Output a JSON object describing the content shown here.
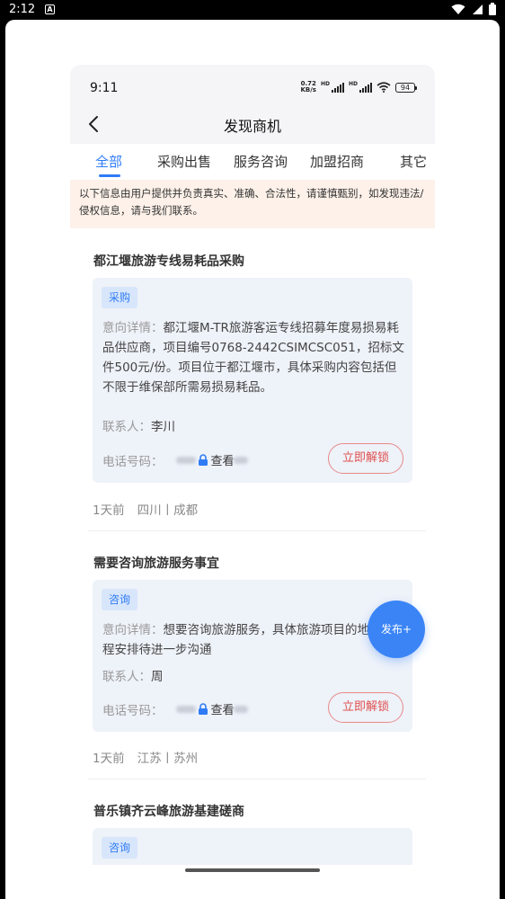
{
  "system_status": {
    "time": "2:12",
    "notification_letter": "A"
  },
  "inner_status": {
    "time": "9:11",
    "speed_value": "0.72",
    "speed_unit": "KB/s",
    "hd_label": "HD",
    "battery": "94"
  },
  "nav": {
    "title": "发现商机"
  },
  "tabs": [
    {
      "label": "全部",
      "active": true
    },
    {
      "label": "采购出售",
      "active": false
    },
    {
      "label": "服务咨询",
      "active": false
    },
    {
      "label": "加盟招商",
      "active": false
    },
    {
      "label": "其它",
      "active": false
    }
  ],
  "notice": "以下信息由用户提供并负责真实、准确、合法性，请谨慎甄别，如发现违法/侵权信息，请与我们联系。",
  "labels": {
    "detail": "意向详情：",
    "contact": "联系人：",
    "phone": "电话号码：",
    "view": "查看",
    "unlock": "立即解锁"
  },
  "items": [
    {
      "title": "都江堰旅游专线易耗品采购",
      "tag": "采购",
      "detail": "都江堰M-TR旅游客运专线招募年度易损易耗品供应商，项目编号0768-2442CSIMCSC051，招标文件500元/份。项目位于都江堰市，具体采购内容包括但不限于维保部所需易损易耗品。",
      "contact": "李川",
      "time": "1天前",
      "location": "四川丨成都"
    },
    {
      "title": "需要咨询旅游服务事宜",
      "tag": "咨询",
      "detail": "想要咨询旅游服务，具体旅游项目的地和行程安排待进一步沟通",
      "contact": "周",
      "time": "1天前",
      "location": "江苏丨苏州"
    },
    {
      "title": "普乐镇齐云峰旅游基建磋商",
      "tag": "咨询"
    }
  ],
  "fab": {
    "label": "发布+"
  },
  "colors": {
    "accent": "#2f7cf6",
    "unlock": "#e0504f",
    "notice_bg": "#fdf1e9",
    "card_bg": "#eef2f9"
  }
}
